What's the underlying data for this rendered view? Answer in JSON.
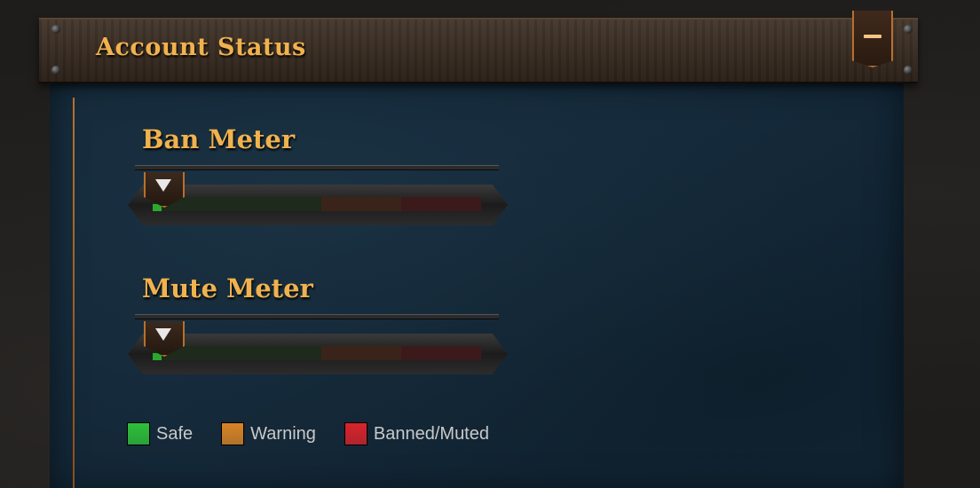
{
  "header": {
    "title": "Account Status",
    "collapse_icon": "minus-icon"
  },
  "meters": [
    {
      "title": "Ban Meter",
      "level_percent": 0
    },
    {
      "title": "Mute Meter",
      "level_percent": 0
    }
  ],
  "legend": {
    "safe": {
      "label": "Safe",
      "color": "#2fbf3a"
    },
    "warning": {
      "label": "Warning",
      "color": "#d98426"
    },
    "banned": {
      "label": "Banned/Muted",
      "color": "#d8242b"
    }
  },
  "colors": {
    "accent": "#f0b24e",
    "border": "#b8702e",
    "panel": "#132737"
  }
}
